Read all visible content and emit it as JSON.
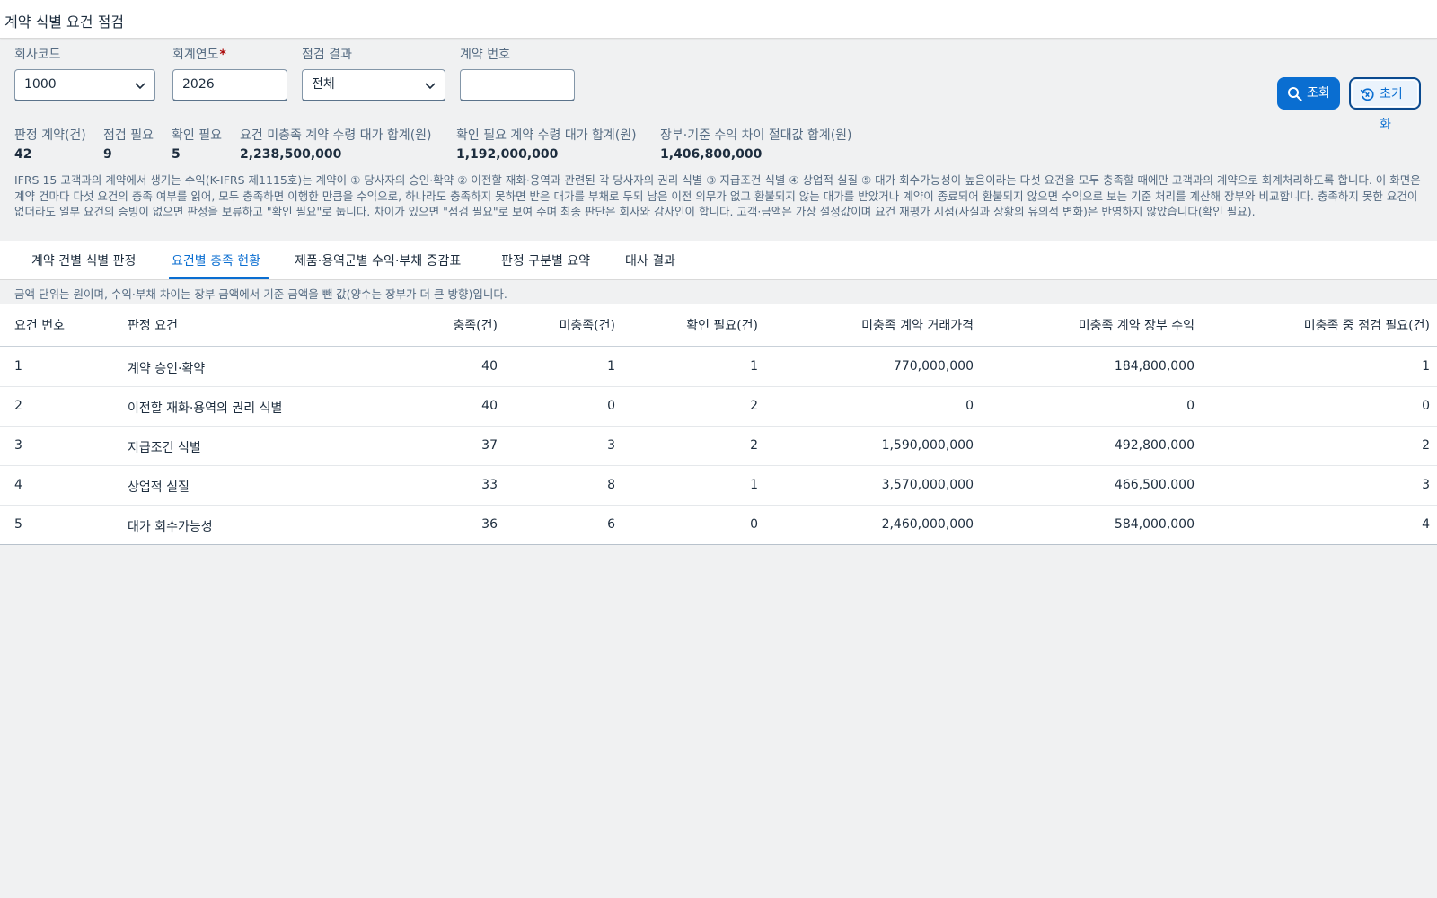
{
  "page": {
    "title": "계약 식별 요건 점검"
  },
  "filters": {
    "company_code": {
      "label": "회사코드",
      "value": "1000"
    },
    "fiscal_year": {
      "label": "회계연도",
      "required_mark": "*",
      "value": "2026"
    },
    "check_result": {
      "label": "점검 결과",
      "value": "전체"
    },
    "contract_no": {
      "label": "계약 번호",
      "value": ""
    }
  },
  "buttons": {
    "search": "조회",
    "reset": "초기화"
  },
  "kpis": [
    {
      "label": "판정 계약(건)",
      "value": "42"
    },
    {
      "label": "점검 필요",
      "value": "9"
    },
    {
      "label": "확인 필요",
      "value": "5"
    },
    {
      "label": "요건 미충족 계약 수령 대가 합계(원)",
      "value": "2,238,500,000"
    },
    {
      "label": "확인 필요 계약 수령 대가 합계(원)",
      "value": "1,192,000,000"
    },
    {
      "label": "장부·기준 수익 차이 절대값 합계(원)",
      "value": "1,406,800,000"
    }
  ],
  "description": "IFRS 15 고객과의 계약에서 생기는 수익(K-IFRS 제1115호)는 계약이 ① 당사자의 승인·확약 ② 이전할 재화·용역과 관련된 각 당사자의 권리 식별 ③ 지급조건 식별 ④ 상업적 실질 ⑤ 대가 회수가능성이 높음이라는 다섯 요건을 모두 충족할 때에만 고객과의 계약으로 회계처리하도록 합니다. 이 화면은 계약 건마다 다섯 요건의 충족 여부를 읽어, 모두 충족하면 이행한 만큼을 수익으로, 하나라도 충족하지 못하면 받은 대가를 부채로 두되 남은 이전 의무가 없고 환불되지 않는 대가를 받았거나 계약이 종료되어 환불되지 않으면 수익으로 보는 기준 처리를 계산해 장부와 비교합니다. 충족하지 못한 요건이 없더라도 일부 요건의 증빙이 없으면 판정을 보류하고 \"확인 필요\"로 둡니다. 차이가 있으면 \"점검 필요\"로 보여 주며 최종 판단은 회사와 감사인이 합니다. 고객·금액은 가상 설정값이며 요건 재평가 시점(사실과 상황의 유의적 변화)은 반영하지 않았습니다(확인 필요).",
  "tabs": [
    {
      "label": "계약 건별 식별 판정",
      "active": false
    },
    {
      "label": "요건별 충족 현황",
      "active": true
    },
    {
      "label": "제품·용역군별 수익·부채 증감표",
      "active": false
    },
    {
      "label": "판정 구분별 요약",
      "active": false
    },
    {
      "label": "대사 결과",
      "active": false
    }
  ],
  "note": "금액 단위는 원이며, 수익·부채 차이는 장부 금액에서 기준 금액을 뺀 값(양수는 장부가 더 큰 방향)입니다.",
  "table": {
    "columns": [
      "요건 번호",
      "판정 요건",
      "충족(건)",
      "미충족(건)",
      "확인 필요(건)",
      "미충족 계약 거래가격",
      "미충족 계약 장부 수익",
      "미충족 중 점검 필요(건)"
    ],
    "rows": [
      [
        "1",
        "계약 승인·확약",
        "40",
        "1",
        "1",
        "770,000,000",
        "184,800,000",
        "1"
      ],
      [
        "2",
        "이전할 재화·용역의 권리 식별",
        "40",
        "0",
        "2",
        "0",
        "0",
        "0"
      ],
      [
        "3",
        "지급조건 식별",
        "37",
        "3",
        "2",
        "1,590,000,000",
        "492,800,000",
        "2"
      ],
      [
        "4",
        "상업적 실질",
        "33",
        "8",
        "1",
        "3,570,000,000",
        "466,500,000",
        "3"
      ],
      [
        "5",
        "대가 회수가능성",
        "36",
        "6",
        "0",
        "2,460,000,000",
        "584,000,000",
        "4"
      ]
    ]
  }
}
